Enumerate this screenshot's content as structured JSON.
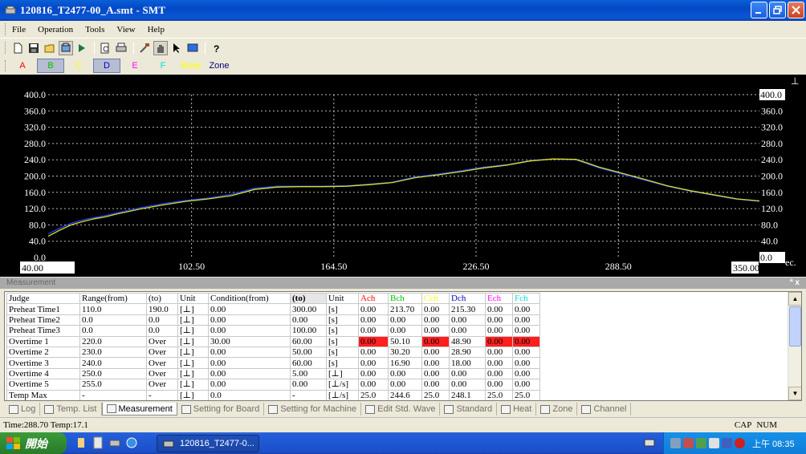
{
  "window": {
    "title": "120816_T2477-00_A.smt - SMT"
  },
  "menu": [
    "File",
    "Operation",
    "Tools",
    "View",
    "Help"
  ],
  "toolbar": {
    "icons": [
      "new-icon",
      "save-icon",
      "open-icon",
      "board-icon",
      "run-icon",
      "print-preview-icon",
      "print-icon",
      "tools-icon",
      "hand-icon",
      "pointer-icon",
      "monitor-icon",
      "help-icon"
    ]
  },
  "channels": [
    {
      "label": "A",
      "color": "#ff0000"
    },
    {
      "label": "B",
      "color": "#00c000"
    },
    {
      "label": "C",
      "color": "#ffff00"
    },
    {
      "label": "D",
      "color": "#0000c0"
    },
    {
      "label": "E",
      "color": "#ff00ff"
    },
    {
      "label": "F",
      "color": "#00e0e0"
    },
    {
      "label": "Base",
      "color": "#ffff00"
    },
    {
      "label": "Zone",
      "color": "#000080"
    }
  ],
  "chart_data": {
    "type": "line",
    "y_ticks": [
      "400.0",
      "360.0",
      "320.0",
      "280.0",
      "240.0",
      "200.0",
      "160.0",
      "120.0",
      "80.0",
      "40.0",
      "0.0"
    ],
    "x_ticks": [
      "40.00",
      "102.50",
      "164.50",
      "226.50",
      "288.50",
      "350.00"
    ],
    "xlim": [
      40,
      350
    ],
    "ylim": [
      0,
      400
    ],
    "x_unit": "ec.",
    "corner_marker": "⊥",
    "grid": true,
    "series": [
      {
        "color": "#2040ff",
        "x": [
          40,
          45,
          50,
          55,
          60,
          65,
          70,
          80,
          90,
          100,
          110,
          120,
          130,
          140,
          150,
          160,
          170,
          180,
          190,
          200,
          210,
          220,
          230,
          240,
          250,
          260,
          270,
          275,
          280,
          290,
          300,
          310,
          320,
          330,
          340,
          350
        ],
        "y": [
          58,
          72,
          84,
          92,
          98,
          103,
          110,
          122,
          132,
          140,
          146,
          155,
          170,
          175,
          175,
          175,
          176,
          180,
          185,
          198,
          205,
          213,
          222,
          228,
          238,
          242,
          240,
          230,
          220,
          205,
          190,
          175,
          163,
          153,
          143,
          138
        ]
      },
      {
        "color": "#d8e020",
        "x": [
          40,
          45,
          50,
          55,
          60,
          65,
          70,
          80,
          90,
          100,
          110,
          120,
          130,
          140,
          150,
          160,
          170,
          180,
          190,
          200,
          210,
          220,
          230,
          240,
          250,
          260,
          270,
          275,
          280,
          290,
          300,
          310,
          320,
          330,
          340,
          350
        ],
        "y": [
          52,
          67,
          80,
          88,
          95,
          100,
          107,
          119,
          129,
          138,
          144,
          152,
          167,
          173,
          174,
          174,
          175,
          179,
          184,
          196,
          203,
          211,
          220,
          227,
          237,
          242,
          241,
          232,
          222,
          207,
          192,
          176,
          164,
          154,
          144,
          139
        ]
      }
    ]
  },
  "measurement": {
    "pane_title": "Measurement",
    "pane_controls": "ª x",
    "columns": [
      "Judge",
      "Range(from)",
      "(to)",
      "Unit",
      "Condition(from)",
      "(to)",
      "Unit",
      "Ach",
      "Bch",
      "Cch",
      "Dch",
      "Ech",
      "Fch"
    ],
    "column_colors": {
      "Ach": "#ff0000",
      "Bch": "#00c000",
      "Cch": "#ffff00",
      "Dch": "#0000c0",
      "Ech": "#ff00ff",
      "Fch": "#00e0e0"
    },
    "rows": [
      [
        "Preheat Time1",
        "110.0",
        "190.0",
        "[⊥]",
        "0.00",
        "300.00",
        "[s]",
        "0.00",
        "213.70",
        "0.00",
        "215.30",
        "0.00",
        "0.00"
      ],
      [
        "Preheat Time2",
        "0.0",
        "0.0",
        "[⊥]",
        "0.00",
        "0.00",
        "[s]",
        "0.00",
        "0.00",
        "0.00",
        "0.00",
        "0.00",
        "0.00"
      ],
      [
        "Preheat Time3",
        "0.0",
        "0.0",
        "[⊥]",
        "0.00",
        "100.00",
        "[s]",
        "0.00",
        "0.00",
        "0.00",
        "0.00",
        "0.00",
        "0.00"
      ],
      [
        "Overtime 1",
        "220.0",
        "Over",
        "[⊥]",
        "30.00",
        "60.00",
        "[s]",
        "0.00",
        "50.10",
        "0.00",
        "48.90",
        "0.00",
        "0.00"
      ],
      [
        "Overtime 2",
        "230.0",
        "Over",
        "[⊥]",
        "0.00",
        "50.00",
        "[s]",
        "0.00",
        "30.20",
        "0.00",
        "28.90",
        "0.00",
        "0.00"
      ],
      [
        "Overtime 3",
        "240.0",
        "Over",
        "[⊥]",
        "0.00",
        "60.00",
        "[s]",
        "0.00",
        "16.90",
        "0.00",
        "18.00",
        "0.00",
        "0.00"
      ],
      [
        "Overtime 4",
        "250.0",
        "Over",
        "[⊥]",
        "0.00",
        "5.00",
        "[⊥]",
        "0.00",
        "0.00",
        "0.00",
        "0.00",
        "0.00",
        "0.00"
      ],
      [
        "Overtime 5",
        "255.0",
        "Over",
        "[⊥]",
        "0.00",
        "0.00",
        "[⊥/s]",
        "0.00",
        "0.00",
        "0.00",
        "0.00",
        "0.00",
        "0.00"
      ],
      [
        "Temp Max",
        "-",
        "-",
        "[⊥]",
        "0.0",
        "-",
        "[⊥/s]",
        "25.0",
        "244.6",
        "25.0",
        "248.1",
        "25.0",
        "25.0"
      ]
    ],
    "highlight_red": [
      [
        3,
        7
      ],
      [
        3,
        9
      ],
      [
        3,
        11
      ],
      [
        3,
        12
      ]
    ]
  },
  "tabs": [
    "Log",
    "Temp. List",
    "Measurement",
    "Setting for Board",
    "Setting for Machine",
    "Edit Std. Wave",
    "Standard",
    "Heat",
    "Zone",
    "Channel"
  ],
  "active_tab": "Measurement",
  "status": {
    "time_label": "Time:288.70",
    "temp_label": "Temp:17.1",
    "cap": "CAP",
    "num": "NUM"
  },
  "taskbar": {
    "start_label": "開始",
    "task_title": "120816_T2477-0...",
    "clock": "上午 08:35"
  }
}
